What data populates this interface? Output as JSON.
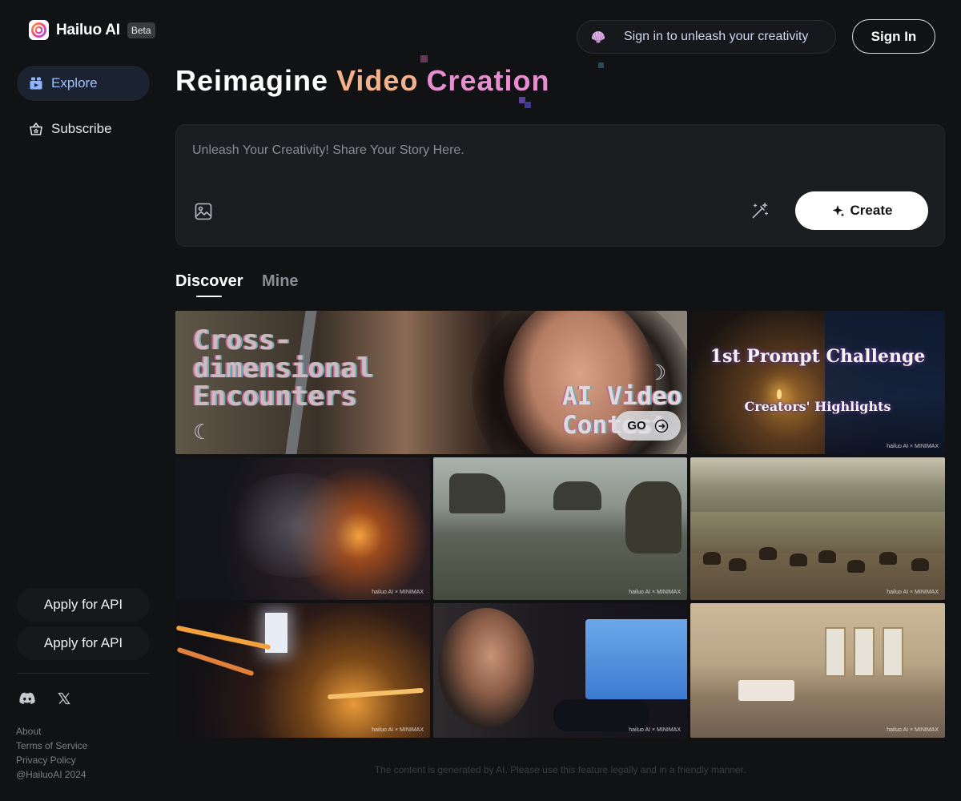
{
  "brand": {
    "name": "Hailuo AI",
    "badge": "Beta"
  },
  "sidebar": {
    "nav": [
      {
        "label": "Explore",
        "icon": "explore-icon",
        "active": true
      },
      {
        "label": "Subscribe",
        "icon": "basket-icon",
        "active": false
      }
    ],
    "api_buttons": [
      "Apply for API",
      "Apply for API"
    ],
    "social": [
      "discord-icon",
      "x-icon"
    ],
    "footer_links": [
      "About",
      "Terms of Service",
      "Privacy Policy"
    ],
    "copyright": "@HailuoAI 2024"
  },
  "header": {
    "signin_prompt": "Sign in to unleash your creativity",
    "signin_button": "Sign In"
  },
  "hero": {
    "word1": "Reimagine",
    "word2": "Video",
    "word3": "Creation"
  },
  "prompt": {
    "placeholder": "Unleash Your Creativity! Share Your Story Here.",
    "value": "",
    "create_label": "Create"
  },
  "tabs": [
    {
      "label": "Discover",
      "active": true
    },
    {
      "label": "Mine",
      "active": false
    }
  ],
  "gallery": {
    "banner": {
      "title": "Cross-dimensional Encounters",
      "subtitle": "AI Video Contest",
      "go_label": "GO"
    },
    "challenge": {
      "title": "1st Prompt Challenge",
      "subtitle": "Creators' Highlights",
      "watermark": "hailuo AI  ×  MINIMAX"
    },
    "watermark": "hailuo AI  ×  MINIMAX"
  },
  "disclaimer": "The content is generated by AI. Please use this feature legally and in a friendly manner.",
  "colors": {
    "background": "#111214",
    "accent_blue": "#9ec0ff",
    "hero_orange": "#f3b18c",
    "hero_pink": "#e68fd0"
  }
}
